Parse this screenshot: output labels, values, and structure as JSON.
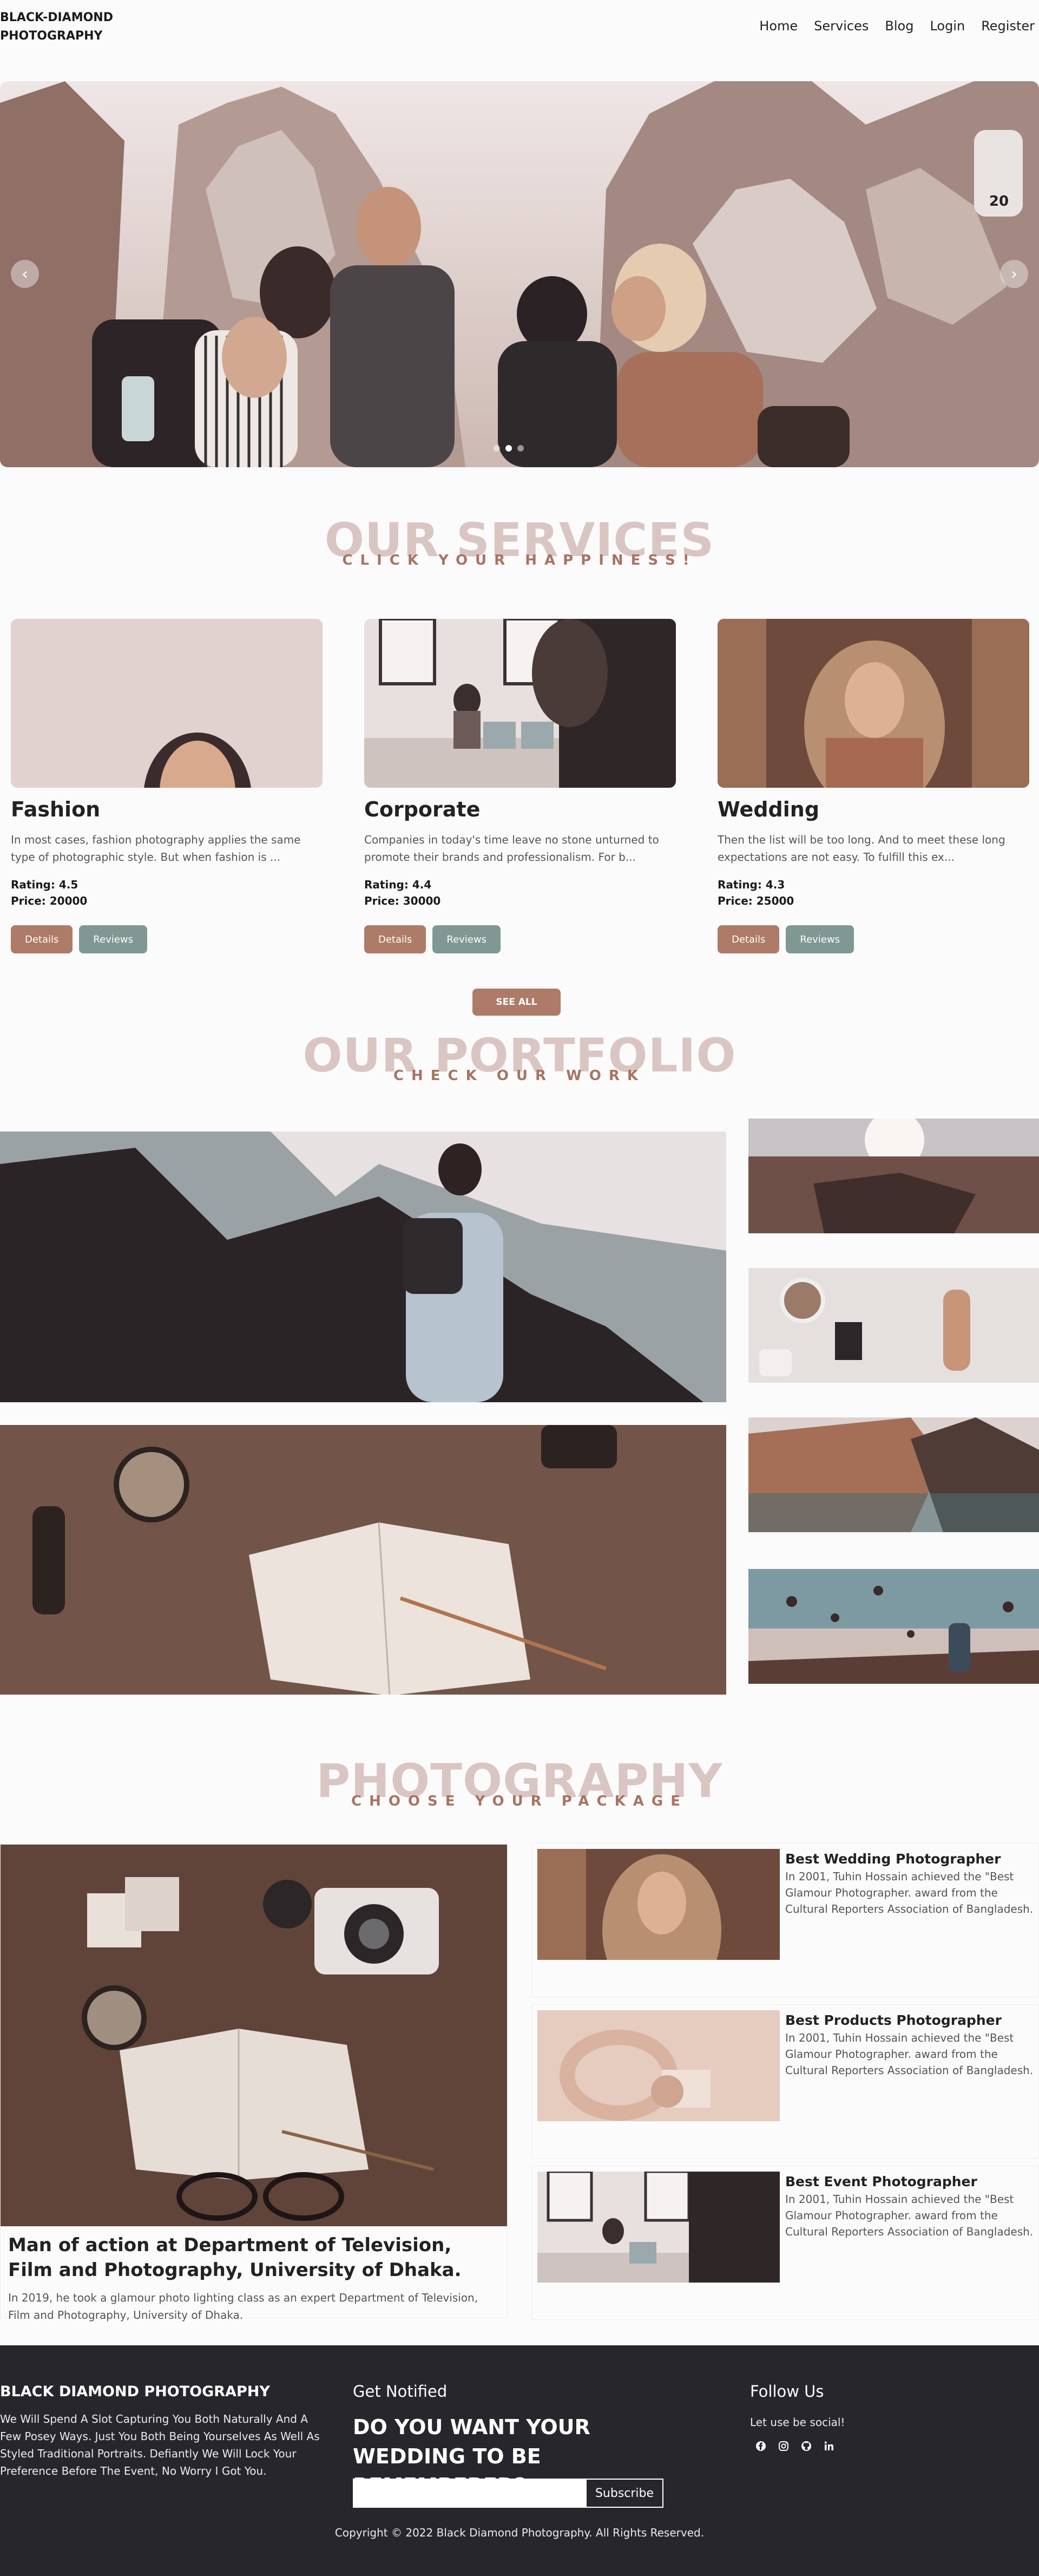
{
  "header": {
    "brand": "BLACK-DIAMOND PHOTOGRAPHY",
    "nav": [
      "Home",
      "Services",
      "Blog",
      "Login",
      "Register"
    ]
  },
  "hero": {
    "prev": "‹",
    "next": "›",
    "caption_plate": "20"
  },
  "services": {
    "title": "OUR SERVICES",
    "subtitle": "CLICK YOUR HAPPINESS!",
    "cards": [
      {
        "title": "Fashion",
        "desc": "In most cases, fashion photography applies the same type of photographic style. But when fashion is ...",
        "rating": "Rating: 4.5",
        "price": "Price: 20000"
      },
      {
        "title": "Corporate",
        "desc": "Companies in today's time leave no stone unturned to promote their brands and professionalism. For b...",
        "rating": "Rating: 4.4",
        "price": "Price: 30000"
      },
      {
        "title": "Wedding",
        "desc": "Then the list will be too long. And to meet these long expectations are not easy. To fulfill this ex...",
        "rating": "Rating: 4.3",
        "price": "Price: 25000"
      }
    ],
    "details_label": "Details",
    "reviews_label": "Reviews",
    "see_all": "SEE ALL"
  },
  "portfolio": {
    "title": "OUR PORTFOLIO",
    "subtitle": "CHECK OUR WORK"
  },
  "photography": {
    "title": "PHOTOGRAPHY",
    "subtitle": "CHOOSE YOUR PACKAGE",
    "feature": {
      "title": "Man of action at Department of Television, Film and Photography, University of Dhaka.",
      "desc": "In 2019, he took a glamour photo lighting class as an expert Department of Television, Film and Photography, University of Dhaka."
    },
    "items": [
      {
        "title": "Best Wedding Photographer",
        "desc": "In 2001, Tuhin Hossain achieved the \"Best Glamour Photographer. award from the Cultural Reporters Association of Bangladesh."
      },
      {
        "title": "Best Products Photographer",
        "desc": "In 2001, Tuhin Hossain achieved the \"Best Glamour Photographer. award from the Cultural Reporters Association of Bangladesh."
      },
      {
        "title": "Best Event Photographer",
        "desc": "In 2001, Tuhin Hossain achieved the \"Best Glamour Photographer. award from the Cultural Reporters Association of Bangladesh."
      }
    ]
  },
  "footer": {
    "brand": "BLACK DIAMOND PHOTOGRAPHY",
    "about": "We Will Spend A Slot Capturing You Both Naturally And A Few Posey Ways. Just You Both Being Yourselves As Well As Styled Traditional Portraits. Defiantly We Will Lock Your Preference Before The Event, No Worry I Got You.",
    "notified": "Get Notified",
    "question": "DO YOU WANT YOUR WEDDING TO BE REMEMBERED?",
    "email_placeholder": "",
    "subscribe": "Subscribe",
    "follow": "Follow Us",
    "social_text": "Let use be social!",
    "copyright": "Copyright © 2022 Black Diamond Photography. All Rights Reserved.",
    "icons": [
      "facebook-icon",
      "instagram-icon",
      "github-icon",
      "linkedin-icon"
    ]
  }
}
